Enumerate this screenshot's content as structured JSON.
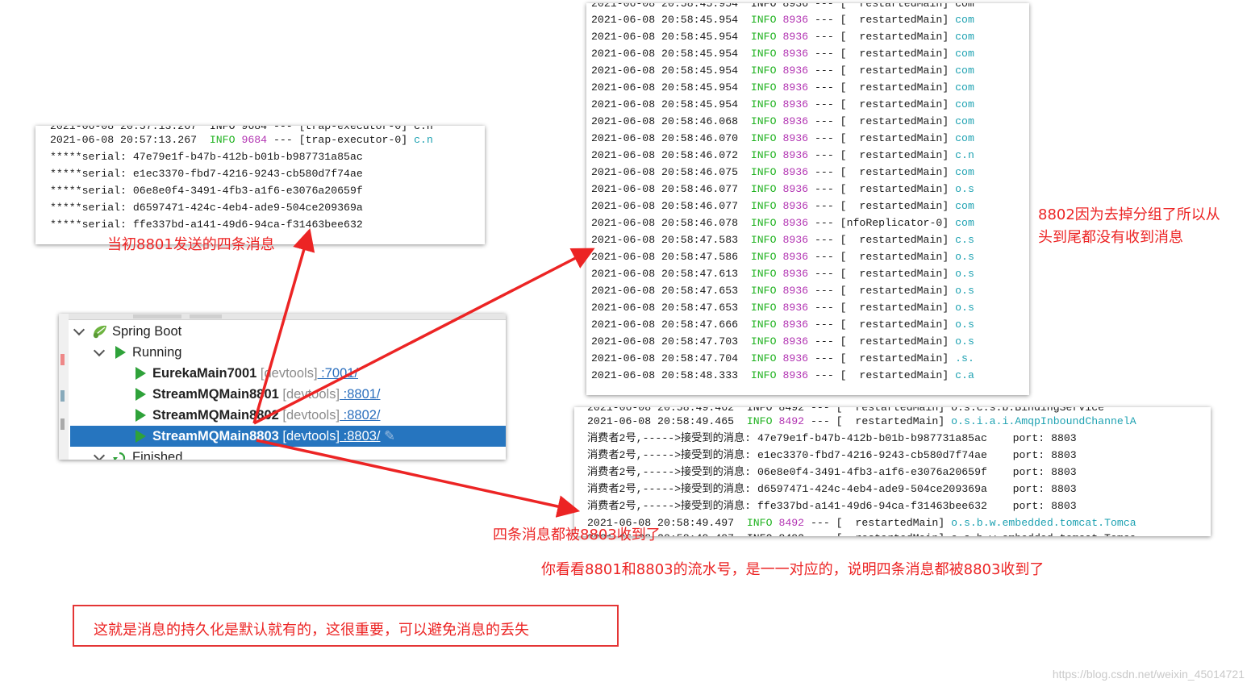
{
  "panel_8801": {
    "cut_line": "2021-06-08 20:57:13.267  INFO 9684 --- [trap-executor-0] c.n",
    "log_line": {
      "ts": "2021-06-08 20:57:13.267",
      "level": "INFO",
      "pid": "9684",
      "sep": " --- ",
      "thread": "[trap-executor-0]",
      "logger": "c.n"
    },
    "serial_lines": [
      "*****serial: 47e79e1f-b47b-412b-b01b-b987731a85ac",
      "*****serial: e1ec3370-fbd7-4216-9243-cb580d7f74ae",
      "*****serial: 06e8e0f4-3491-4fb3-a1f6-e3076a20659f",
      "*****serial: d6597471-424c-4eb4-ade9-504ce209369a",
      "*****serial: ffe337bd-a141-49d6-94ca-f31463bee632"
    ]
  },
  "panel_8802": {
    "cut_line": "2021-06-08 20:58:45.954  INFO 8936 --- [  restartedMain] com",
    "rows": [
      {
        "ts": "2021-06-08 20:58:45.954",
        "level": "INFO",
        "pid": "8936",
        "sep": " --- ",
        "thread": "[  restartedMain]",
        "logger": "com"
      },
      {
        "ts": "2021-06-08 20:58:45.954",
        "level": "INFO",
        "pid": "8936",
        "sep": " --- ",
        "thread": "[  restartedMain]",
        "logger": "com"
      },
      {
        "ts": "2021-06-08 20:58:45.954",
        "level": "INFO",
        "pid": "8936",
        "sep": " --- ",
        "thread": "[  restartedMain]",
        "logger": "com"
      },
      {
        "ts": "2021-06-08 20:58:45.954",
        "level": "INFO",
        "pid": "8936",
        "sep": " --- ",
        "thread": "[  restartedMain]",
        "logger": "com"
      },
      {
        "ts": "2021-06-08 20:58:45.954",
        "level": "INFO",
        "pid": "8936",
        "sep": " --- ",
        "thread": "[  restartedMain]",
        "logger": "com"
      },
      {
        "ts": "2021-06-08 20:58:45.954",
        "level": "INFO",
        "pid": "8936",
        "sep": " --- ",
        "thread": "[  restartedMain]",
        "logger": "com"
      },
      {
        "ts": "2021-06-08 20:58:46.068",
        "level": "INFO",
        "pid": "8936",
        "sep": " --- ",
        "thread": "[  restartedMain]",
        "logger": "com"
      },
      {
        "ts": "2021-06-08 20:58:46.070",
        "level": "INFO",
        "pid": "8936",
        "sep": " --- ",
        "thread": "[  restartedMain]",
        "logger": "com"
      },
      {
        "ts": "2021-06-08 20:58:46.072",
        "level": "INFO",
        "pid": "8936",
        "sep": " --- ",
        "thread": "[  restartedMain]",
        "logger": "c.n"
      },
      {
        "ts": "2021-06-08 20:58:46.075",
        "level": "INFO",
        "pid": "8936",
        "sep": " --- ",
        "thread": "[  restartedMain]",
        "logger": "com"
      },
      {
        "ts": "2021-06-08 20:58:46.077",
        "level": "INFO",
        "pid": "8936",
        "sep": " --- ",
        "thread": "[  restartedMain]",
        "logger": "o.s"
      },
      {
        "ts": "2021-06-08 20:58:46.077",
        "level": "INFO",
        "pid": "8936",
        "sep": " --- ",
        "thread": "[  restartedMain]",
        "logger": "com"
      },
      {
        "ts": "2021-06-08 20:58:46.078",
        "level": "INFO",
        "pid": "8936",
        "sep": " --- ",
        "thread": "[nfoReplicator-0]",
        "logger": "com"
      },
      {
        "ts": "2021-06-08 20:58:47.583",
        "level": "INFO",
        "pid": "8936",
        "sep": " --- ",
        "thread": "[  restartedMain]",
        "logger": "c.s"
      },
      {
        "ts": "2021-06-08 20:58:47.586",
        "level": "INFO",
        "pid": "8936",
        "sep": " --- ",
        "thread": "[  restartedMain]",
        "logger": "o.s"
      },
      {
        "ts": "2021-06-08 20:58:47.613",
        "level": "INFO",
        "pid": "8936",
        "sep": " --- ",
        "thread": "[  restartedMain]",
        "logger": "o.s"
      },
      {
        "ts": "2021-06-08 20:58:47.653",
        "level": "INFO",
        "pid": "8936",
        "sep": " --- ",
        "thread": "[  restartedMain]",
        "logger": "o.s"
      },
      {
        "ts": "2021-06-08 20:58:47.653",
        "level": "INFO",
        "pid": "8936",
        "sep": " --- ",
        "thread": "[  restartedMain]",
        "logger": "o.s"
      },
      {
        "ts": "2021-06-08 20:58:47.666",
        "level": "INFO",
        "pid": "8936",
        "sep": " --- ",
        "thread": "[  restartedMain]",
        "logger": "o.s"
      },
      {
        "ts": "2021-06-08 20:58:47.703",
        "level": "INFO",
        "pid": "8936",
        "sep": " --- ",
        "thread": "[  restartedMain]",
        "logger": "o.s"
      },
      {
        "ts": "2021-06-08 20:58:47.704",
        "level": "INFO",
        "pid": "8936",
        "sep": " --- ",
        "thread": "[  restartedMain]",
        "logger": ".s."
      },
      {
        "ts": "2021-06-08 20:58:48.333",
        "level": "INFO",
        "pid": "8936",
        "sep": " --- ",
        "thread": "[  restartedMain]",
        "logger": "c.a"
      }
    ]
  },
  "panel_8803": {
    "cut_line": "2021-06-08 20:58:49.462  INFO 8492 --- [  restartedMain] o.s.c.s.b.BindingService",
    "first_log": {
      "ts": "2021-06-08 20:58:49.465",
      "level": "INFO",
      "pid": "8492",
      "sep": " --- ",
      "thread": "[  restartedMain]",
      "logger": "o.s.i.a.i.AmqpInboundChannelA"
    },
    "consumer_lines": [
      {
        "prefix": "消费者2号,----->接受到的消息: ",
        "serial": "47e79e1f-b47b-412b-b01b-b987731a85ac",
        "port_label": "port: ",
        "port": "8803"
      },
      {
        "prefix": "消费者2号,----->接受到的消息: ",
        "serial": "e1ec3370-fbd7-4216-9243-cb580d7f74ae",
        "port_label": "port: ",
        "port": "8803"
      },
      {
        "prefix": "消费者2号,----->接受到的消息: ",
        "serial": "06e8e0f4-3491-4fb3-a1f6-e3076a20659f",
        "port_label": "port: ",
        "port": "8803"
      },
      {
        "prefix": "消费者2号,----->接受到的消息: ",
        "serial": "d6597471-424c-4eb4-ade9-504ce209369a",
        "port_label": "port: ",
        "port": "8803"
      },
      {
        "prefix": "消费者2号,----->接受到的消息: ",
        "serial": "ffe337bd-a141-49d6-94ca-f31463bee632",
        "port_label": "port: ",
        "port": "8803"
      }
    ],
    "last_log": {
      "ts": "2021-06-08 20:58:49.497",
      "level": "INFO",
      "pid": "8492",
      "sep": " --- ",
      "thread": "[  restartedMain]",
      "logger": "o.s.b.w.embedded.tomcat.Tomca"
    },
    "bottom_cut": "2021-06-08 20:58:49.497  INFO 8492 --- [  restartedMain] o.s.b.w.embedded.tomcat.Tomca"
  },
  "tree": {
    "root": "Spring Boot",
    "running": "Running",
    "apps": [
      {
        "name": "EurekaMain7001",
        "devtools": " [devtools]",
        "port": " :7001/"
      },
      {
        "name": "StreamMQMain8801",
        "devtools": " [devtools]",
        "port": " :8801/"
      },
      {
        "name": "StreamMQMain8802",
        "devtools": " [devtools]",
        "port": " :8802/"
      },
      {
        "name": "StreamMQMain8803",
        "devtools": " [devtools]",
        "port": " :8803/"
      }
    ],
    "finished": "Finished"
  },
  "annotations": {
    "a8801": "当初8801发送的四条消息",
    "a8802": "8802因为去掉分组了所以从\n头到尾都没有收到消息",
    "a8803": "四条消息都被8803收到了",
    "match": "你看看8801和8803的流水号，是一一对应的，说明四条消息都被8803收到了",
    "box": "这就是消息的持久化是默认就有的，这很重要，可以避免消息的丢失"
  },
  "watermark": "https://blog.csdn.net/weixin_45014721",
  "colors": {
    "accent_red": "#ec2424",
    "selection": "#2675bf",
    "run_green": "#2fa23a",
    "info_green": "#1fb21f",
    "pid_purple": "#b234b2",
    "logger_cyan": "#1fa2b2"
  }
}
